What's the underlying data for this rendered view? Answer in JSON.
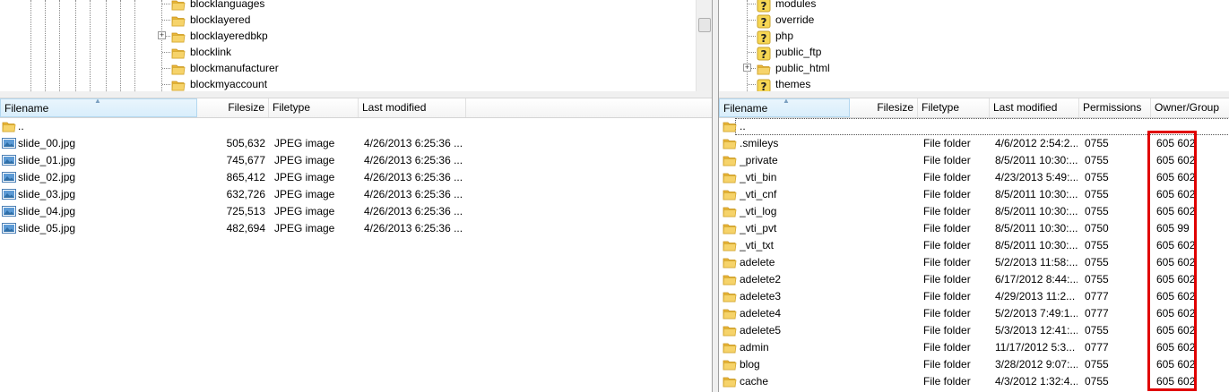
{
  "local": {
    "tree": [
      {
        "label": "blocklanguages",
        "expandable": false
      },
      {
        "label": "blocklayered",
        "expandable": false
      },
      {
        "label": "blocklayeredbkp",
        "expandable": true
      },
      {
        "label": "blocklink",
        "expandable": false
      },
      {
        "label": "blockmanufacturer",
        "expandable": false
      },
      {
        "label": "blockmyaccount",
        "expandable": false
      }
    ],
    "columns": {
      "filename": "Filename",
      "filesize": "Filesize",
      "filetype": "Filetype",
      "modified": "Last modified"
    },
    "parent": "..",
    "files": [
      {
        "name": "slide_00.jpg",
        "size": "505,632",
        "type": "JPEG image",
        "modified": "4/26/2013 6:25:36 ..."
      },
      {
        "name": "slide_01.jpg",
        "size": "745,677",
        "type": "JPEG image",
        "modified": "4/26/2013 6:25:36 ..."
      },
      {
        "name": "slide_02.jpg",
        "size": "865,412",
        "type": "JPEG image",
        "modified": "4/26/2013 6:25:36 ..."
      },
      {
        "name": "slide_03.jpg",
        "size": "632,726",
        "type": "JPEG image",
        "modified": "4/26/2013 6:25:36 ..."
      },
      {
        "name": "slide_04.jpg",
        "size": "725,513",
        "type": "JPEG image",
        "modified": "4/26/2013 6:25:36 ..."
      },
      {
        "name": "slide_05.jpg",
        "size": "482,694",
        "type": "JPEG image",
        "modified": "4/26/2013 6:25:36 ..."
      }
    ]
  },
  "remote": {
    "tree": [
      {
        "label": "modules",
        "icon": "question",
        "expandable": false
      },
      {
        "label": "override",
        "icon": "question",
        "expandable": false
      },
      {
        "label": "php",
        "icon": "question",
        "expandable": false
      },
      {
        "label": "public_ftp",
        "icon": "question",
        "expandable": false
      },
      {
        "label": "public_html",
        "icon": "folder",
        "expandable": true
      },
      {
        "label": "themes",
        "icon": "question",
        "expandable": false
      }
    ],
    "columns": {
      "filename": "Filename",
      "filesize": "Filesize",
      "filetype": "Filetype",
      "modified": "Last modified",
      "permissions": "Permissions",
      "owner": "Owner/Group"
    },
    "parent": "..",
    "files": [
      {
        "name": ".smileys",
        "type": "File folder",
        "modified": "4/6/2012 2:54:2...",
        "perm": "0755",
        "owner": "605 602"
      },
      {
        "name": "_private",
        "type": "File folder",
        "modified": "8/5/2011 10:30:...",
        "perm": "0755",
        "owner": "605 602"
      },
      {
        "name": "_vti_bin",
        "type": "File folder",
        "modified": "4/23/2013 5:49:...",
        "perm": "0755",
        "owner": "605 602"
      },
      {
        "name": "_vti_cnf",
        "type": "File folder",
        "modified": "8/5/2011 10:30:...",
        "perm": "0755",
        "owner": "605 602"
      },
      {
        "name": "_vti_log",
        "type": "File folder",
        "modified": "8/5/2011 10:30:...",
        "perm": "0755",
        "owner": "605 602"
      },
      {
        "name": "_vti_pvt",
        "type": "File folder",
        "modified": "8/5/2011 10:30:...",
        "perm": "0750",
        "owner": "605 99"
      },
      {
        "name": "_vti_txt",
        "type": "File folder",
        "modified": "8/5/2011 10:30:...",
        "perm": "0755",
        "owner": "605 602"
      },
      {
        "name": "adelete",
        "type": "File folder",
        "modified": "5/2/2013 11:58:...",
        "perm": "0755",
        "owner": "605 602"
      },
      {
        "name": "adelete2",
        "type": "File folder",
        "modified": "6/17/2012 8:44:...",
        "perm": "0755",
        "owner": "605 602"
      },
      {
        "name": "adelete3",
        "type": "File folder",
        "modified": "4/29/2013 11:2...",
        "perm": "0777",
        "owner": "605 602"
      },
      {
        "name": "adelete4",
        "type": "File folder",
        "modified": "5/2/2013 7:49:1...",
        "perm": "0777",
        "owner": "605 602"
      },
      {
        "name": "adelete5",
        "type": "File folder",
        "modified": "5/3/2013 12:41:...",
        "perm": "0755",
        "owner": "605 602"
      },
      {
        "name": "admin",
        "type": "File folder",
        "modified": "11/17/2012 5:3...",
        "perm": "0777",
        "owner": "605 602"
      },
      {
        "name": "blog",
        "type": "File folder",
        "modified": "3/28/2012 9:07:...",
        "perm": "0755",
        "owner": "605 602"
      },
      {
        "name": "cache",
        "type": "File folder",
        "modified": "4/3/2012 1:32:4...",
        "perm": "0755",
        "owner": "605 602"
      }
    ]
  },
  "colors": {
    "highlight": "#e00000",
    "folder": "#f3c84d",
    "sorted_header": "#d9eefb"
  }
}
